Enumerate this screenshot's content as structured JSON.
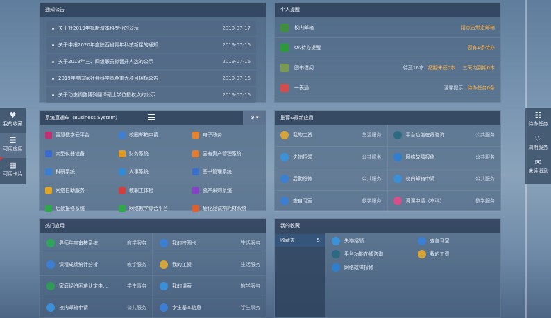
{
  "notice": {
    "title": "通知公告",
    "items": [
      {
        "text": "关于对2019年拟新增本科专业的公示",
        "date": "2019-07-17"
      },
      {
        "text": "关于申报2020年度陕西省青年科技新星的通知",
        "date": "2019-07-16"
      },
      {
        "text": "关于2019年三、四级职员拟晋升人选的公示",
        "date": "2019-07-16"
      },
      {
        "text": "2019年度国家社会科学基金重大项目招标公告",
        "date": "2019-07-16"
      },
      {
        "text": "关于动态调整博列翻译硕士学位授权点的公示",
        "date": "2019-07-16"
      }
    ]
  },
  "reminder": {
    "title": "个人提醒",
    "items": [
      {
        "label": "校内邮箱",
        "icon": "mailbox-icon",
        "color": "#3f8f3f",
        "extra": "",
        "status": "请点击绑定邮箱",
        "status2": ""
      },
      {
        "label": "OA待办提醒",
        "icon": "oa-icon",
        "color": "#2c9a3a",
        "extra": "",
        "status": "您有1条待办",
        "status2": ""
      },
      {
        "label": "图书借阅",
        "icon": "library-icon",
        "color": "#7a9a52",
        "extra": "待还16本",
        "status": "超期未还0本",
        "status2": "三天内到期0本"
      },
      {
        "label": "一表通",
        "icon": "form-icon",
        "color": "#d64b4b",
        "extra": "温馨提示",
        "status": "待办任务0条",
        "status2": ""
      }
    ]
  },
  "system": {
    "title": "系统直通车（Business System）",
    "settings_icon": "gear-icon",
    "items": [
      {
        "label": "智慧教学云平台",
        "color": "#c4306f",
        "icon": "cloud-teach-icon"
      },
      {
        "label": "校园邮箱申请",
        "color": "#3e7fd1",
        "icon": "mail-icon"
      },
      {
        "label": "电子政务",
        "color": "#e8832a",
        "icon": "gov-icon"
      },
      {
        "label": "大型仪器设备",
        "color": "#3a6bd0",
        "icon": "instrument-icon"
      },
      {
        "label": "财务系统",
        "color": "#e19b22",
        "icon": "finance-icon"
      },
      {
        "label": "国有资产管理系统",
        "color": "#e57b2b",
        "icon": "asset-icon"
      },
      {
        "label": "科研系统",
        "color": "#3b7fd4",
        "icon": "research-icon"
      },
      {
        "label": "人事系统",
        "color": "#2f8ad7",
        "icon": "person-icon"
      },
      {
        "label": "图书管理系统",
        "color": "#3a6fcf",
        "icon": "book-icon"
      },
      {
        "label": "网络自助服务",
        "color": "#e1a423",
        "icon": "network-icon"
      },
      {
        "label": "教职工体检",
        "color": "#d63d3d",
        "icon": "health-icon"
      },
      {
        "label": "资产采购系统",
        "color": "#8a3fc9",
        "icon": "purchase-icon"
      },
      {
        "label": "后勤报修系统",
        "color": "#2fa84a",
        "icon": "repair-icon"
      },
      {
        "label": "网络教学综合平台",
        "color": "#2fa84a",
        "icon": "elearn-icon"
      },
      {
        "label": "危化品试剂耗材系统",
        "color": "#e0602b",
        "icon": "chemical-icon"
      }
    ]
  },
  "recommend": {
    "title": "推荐&最新应用",
    "items": [
      {
        "label": "我的工资",
        "cat": "生活服务",
        "color": "#d6a53a",
        "icon": "salary-icon"
      },
      {
        "label": "平台功能在线咨询",
        "cat": "公共服务",
        "color": "#2c6a82",
        "icon": "consult-icon"
      },
      {
        "label": "失物招领",
        "cat": "公共服务",
        "color": "#3b92d8",
        "icon": "lostfound-icon"
      },
      {
        "label": "网络故障报修",
        "cat": "公共服务",
        "color": "#2f7fd0",
        "icon": "netfault-icon"
      },
      {
        "label": "后勤维修",
        "cat": "公共服务",
        "color": "#3a7fd2",
        "icon": "wrench-icon"
      },
      {
        "label": "校内邮箱申请",
        "cat": "公共服务",
        "color": "#3a8fd8",
        "icon": "mail-icon"
      },
      {
        "label": "查自习室",
        "cat": "教学服务",
        "color": "#3b7fd4",
        "icon": "classroom-icon"
      },
      {
        "label": "调课申请（本科）",
        "cat": "教学服务",
        "color": "#d94f8a",
        "icon": "schedule-icon"
      }
    ]
  },
  "hot": {
    "title": "热门应用",
    "items": [
      {
        "label": "导师年度审核系统",
        "cat": "教学服务",
        "color": "#2fa55a",
        "icon": "tutor-icon"
      },
      {
        "label": "我的校园卡",
        "cat": "生活服务",
        "color": "#3b7fd4",
        "icon": "card-icon"
      },
      {
        "label": "课程成绩统计分析",
        "cat": "教学服务",
        "color": "#3b7fd4",
        "icon": "pie-icon"
      },
      {
        "label": "我的工资",
        "cat": "生活服务",
        "color": "#d6a53a",
        "icon": "salary-icon"
      },
      {
        "label": "家庭经济困难认定申…",
        "cat": "学生事务",
        "color": "#2f9a55",
        "icon": "family-icon"
      },
      {
        "label": "我的课表",
        "cat": "教学服务",
        "color": "#3b8fd6",
        "icon": "timetable-icon"
      },
      {
        "label": "校内邮箱申请",
        "cat": "公共服务",
        "color": "#3a8fd8",
        "icon": "mail-icon"
      },
      {
        "label": "学生基本信息",
        "cat": "学生事务",
        "color": "#3b7fd4",
        "icon": "student-icon"
      }
    ]
  },
  "favorites": {
    "title": "我的收藏",
    "folder": {
      "label": "收藏夹",
      "count": "5"
    },
    "items": [
      {
        "label": "失物招领",
        "color": "#3b92d8",
        "icon": "lostfound-icon"
      },
      {
        "label": "查自习室",
        "color": "#3b7fd4",
        "icon": "classroom-icon"
      },
      {
        "label": "平台功能在线咨询",
        "color": "#2c6a82",
        "icon": "consult-icon"
      },
      {
        "label": "我的工资",
        "color": "#d6a53a",
        "icon": "salary-icon"
      },
      {
        "label": "网络故障报修",
        "color": "#2f7fd0",
        "icon": "netfault-icon"
      }
    ]
  },
  "left_side": [
    {
      "label": "我的收藏",
      "glyph": "♥",
      "icon": "heart-icon"
    },
    {
      "label": "可用应用",
      "glyph": "☰",
      "icon": "list-icon"
    },
    {
      "label": "可用卡片",
      "glyph": "▦",
      "icon": "grid-icon"
    }
  ],
  "right_side": [
    {
      "label": "待办任务",
      "glyph": "☷",
      "icon": "task-icon"
    },
    {
      "label": "周期服务",
      "glyph": "♡",
      "icon": "shield-icon"
    },
    {
      "label": "未读消息",
      "glyph": "✉",
      "icon": "message-icon"
    }
  ],
  "colors": {
    "orange": "#ffb13d",
    "panel_head": "#30425c"
  }
}
